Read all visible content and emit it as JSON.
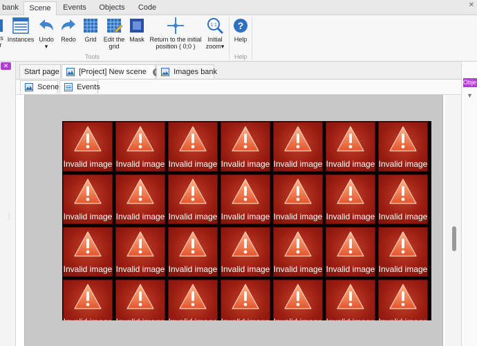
{
  "ribbon": {
    "tabs": [
      {
        "label": "bank",
        "active": false
      },
      {
        "label": "Scene",
        "active": true
      },
      {
        "label": "Events",
        "active": false
      },
      {
        "label": "Objects",
        "active": false
      },
      {
        "label": "Code",
        "active": false
      }
    ],
    "close_glyph": "✕",
    "buttons": {
      "layers": {
        "line1": "rs",
        "line2": "r",
        "icon": "layers-icon"
      },
      "instances": {
        "line1": "Instances",
        "icon": "instances-icon"
      },
      "undo": {
        "line1": "Undo",
        "line2": "▾",
        "icon": "undo-arrow-icon"
      },
      "redo": {
        "line1": "Redo",
        "icon": "redo-arrow-icon"
      },
      "grid": {
        "line1": "Grid",
        "icon": "grid-icon"
      },
      "edit_grid": {
        "line1": "Edit the",
        "line2": "grid",
        "icon": "edit-grid-icon"
      },
      "mask": {
        "line1": "Mask",
        "icon": "mask-icon"
      },
      "return_origin": {
        "line1": "Return to the initial",
        "line2": "position ( 0;0 )",
        "icon": "crosshair-icon"
      },
      "initial_zoom": {
        "line1": "Initial",
        "line2": "zoom▾",
        "icon": "zoom-icon",
        "zoom_text": "1:1"
      },
      "help": {
        "line1": "Help",
        "icon": "help-icon"
      }
    },
    "groups": {
      "tools": "Tools",
      "help": "Help"
    }
  },
  "left_panel": {
    "close_glyph": "✕",
    "grip": "⋮"
  },
  "doc_tabs": [
    {
      "label": "Start page",
      "active": false
    },
    {
      "label": "[Project] New scene",
      "active": true,
      "close": "✕"
    },
    {
      "label": "Images bank",
      "active": false
    }
  ],
  "sub_tabs": [
    {
      "label": "Scene",
      "icon": "scene-icon"
    },
    {
      "label": "Events",
      "icon": "events-list-icon"
    }
  ],
  "scene": {
    "grid_rows": 4,
    "grid_cols": 7,
    "cell_label": "Invalid image",
    "colors": {
      "cell_dark": "#7e120c",
      "cell_light": "#c24226",
      "background": "#c8c8c8"
    }
  },
  "right_panel": {
    "header": "Obje",
    "arrow": "▼"
  },
  "colors": {
    "accent": "#b23cd6",
    "ribbon_bg": "#f7f7f7",
    "tab_bar": "#e9e9e9"
  }
}
